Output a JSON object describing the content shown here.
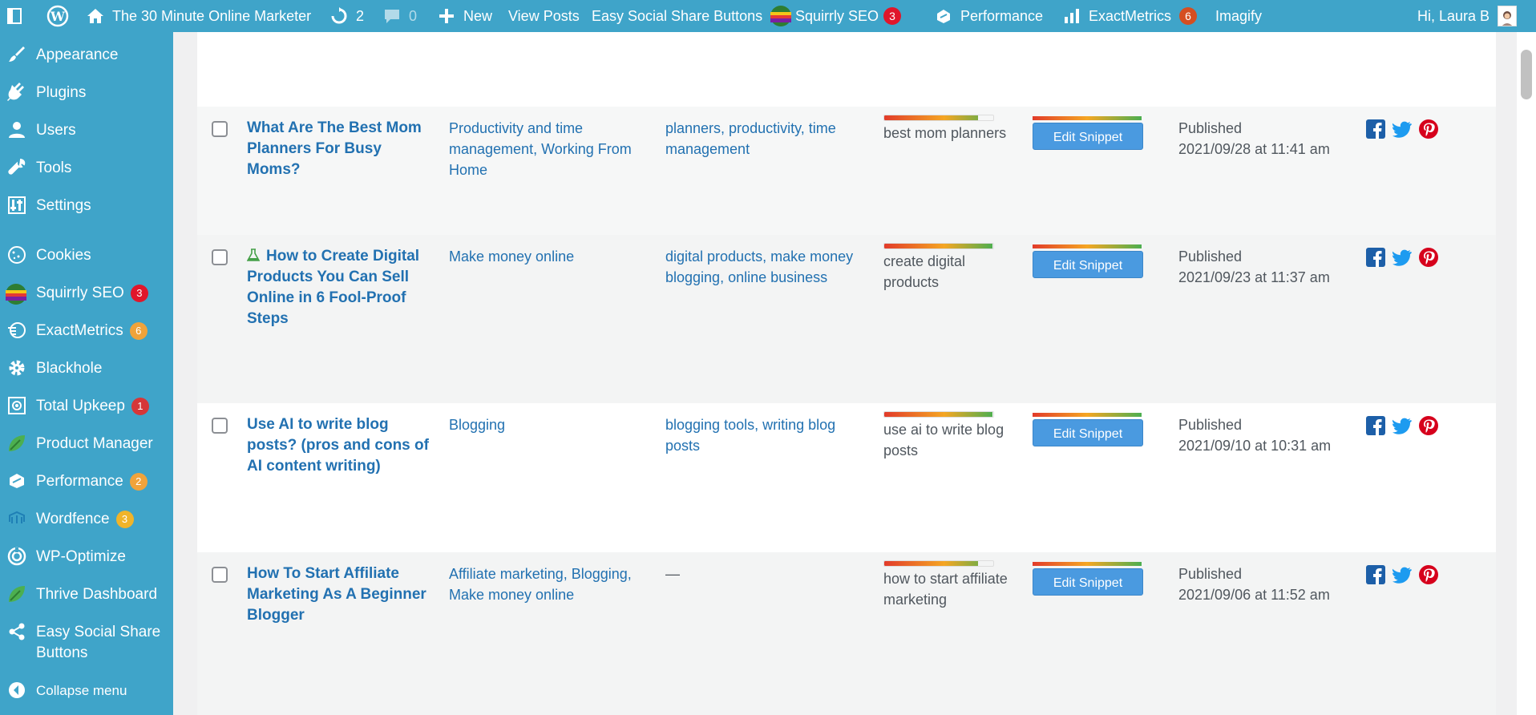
{
  "admin_bar": {
    "site_name": "The 30 Minute Online Marketer",
    "updates_count": "2",
    "comments_count": "0",
    "new_label": "New",
    "view_posts_label": "View Posts",
    "easy_social_label": "Easy Social Share Buttons",
    "squirrly_label": "Squirrly SEO",
    "squirrly_badge": "3",
    "performance_label": "Performance",
    "exactmetrics_label": "ExactMetrics",
    "exactmetrics_badge": "6",
    "imagify_label": "Imagify",
    "greeting": "Hi, Laura B"
  },
  "sidebar": {
    "items": [
      {
        "label": "Appearance",
        "icon": "paintbrush-icon"
      },
      {
        "label": "Plugins",
        "icon": "plug-icon"
      },
      {
        "label": "Users",
        "icon": "user-icon"
      },
      {
        "label": "Tools",
        "icon": "wrench-icon"
      },
      {
        "label": "Settings",
        "icon": "settings-sliders-icon"
      },
      {
        "label": "Cookies",
        "icon": "cookie-icon"
      },
      {
        "label": "Squirrly SEO",
        "icon": "squirrly-icon",
        "badge": "3"
      },
      {
        "label": "ExactMetrics",
        "icon": "exactmetrics-icon",
        "badge": "6"
      },
      {
        "label": "Blackhole",
        "icon": "gear-icon"
      },
      {
        "label": "Total Upkeep",
        "icon": "upkeep-icon",
        "badge": "1"
      },
      {
        "label": "Product Manager",
        "icon": "leaf-icon"
      },
      {
        "label": "Performance",
        "icon": "performance-icon",
        "badge": "2"
      },
      {
        "label": "Wordfence",
        "icon": "wordfence-icon",
        "badge": "3"
      },
      {
        "label": "WP-Optimize",
        "icon": "wp-optimize-icon"
      },
      {
        "label": "Thrive Dashboard",
        "icon": "leaf-icon"
      },
      {
        "label": "Easy Social Share Buttons",
        "icon": "share-icon"
      },
      {
        "label": "Collapse menu",
        "icon": "collapse-icon"
      }
    ]
  },
  "posts": [
    {
      "title": "What Are The Best Mom Planners For Busy Moms?",
      "categories": "Productivity and time management, Working From Home",
      "tags": "planners, productivity, time management",
      "keyword": "best mom planners",
      "keyword_score": 0.86,
      "snippet_label": "Edit Snippet",
      "status": "Published",
      "date": "2021/09/28 at 11:41 am"
    },
    {
      "title": "How to Create Digital Products You Can Sell Online in 6 Fool-Proof Steps",
      "categories": "Make money online",
      "tags": "digital products, make money blogging, online business",
      "keyword": "create digital products",
      "keyword_score": 0.99,
      "snippet_label": "Edit Snippet",
      "status": "Published",
      "date": "2021/09/23 at 11:37 am"
    },
    {
      "title": "Use AI to write blog posts? (pros and cons of AI content writing)",
      "categories": "Blogging",
      "tags": "blogging tools, writing blog posts",
      "keyword": "use ai to write blog posts",
      "keyword_score": 0.99,
      "snippet_label": "Edit Snippet",
      "status": "Published",
      "date": "2021/09/10 at 10:31 am"
    },
    {
      "title": "How To Start Affiliate Marketing As A Beginner Blogger",
      "categories": "Affiliate marketing, Blogging, Make money online",
      "tags": "—",
      "keyword": "how to start affiliate marketing",
      "keyword_score": 0.86,
      "snippet_label": "Edit Snippet",
      "status": "Published",
      "date": "2021/09/06 at 11:52 am"
    }
  ],
  "colors": {
    "sidebar_bg": "#3fa4c9",
    "link": "#2271b1",
    "snippet_button": "#4a9ae0"
  }
}
